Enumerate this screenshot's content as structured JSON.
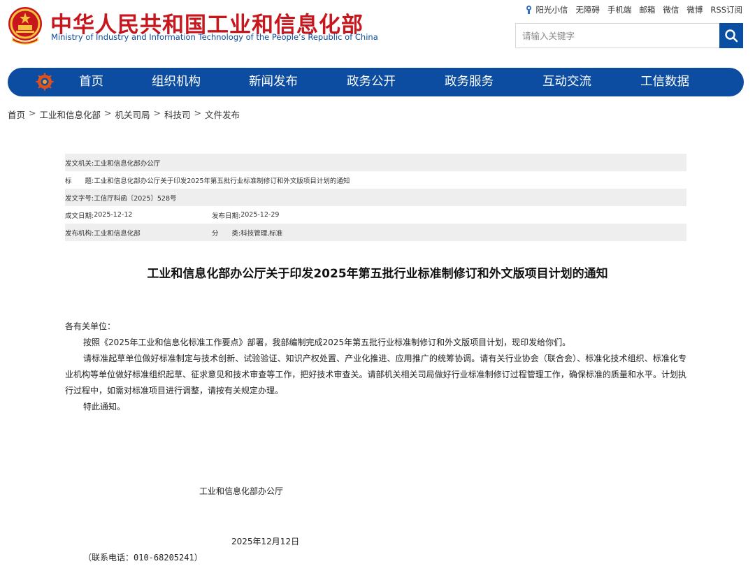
{
  "header": {
    "title": "中华人民共和国工业和信息化部",
    "subtitle": "Ministry of Industry and Information Technology of the People’s Republic of China",
    "brand_red": "#c8161d",
    "brand_blue": "#0c4da2"
  },
  "toplinks": [
    "阳光小信",
    "无障碍",
    "手机端",
    "邮箱",
    "微信",
    "微博",
    "RSS订阅"
  ],
  "search": {
    "placeholder": "请输入关键字",
    "value": ""
  },
  "nav": {
    "items": [
      "首页",
      "组织机构",
      "新闻发布",
      "政务公开",
      "政务服务",
      "互动交流",
      "工信数据"
    ]
  },
  "breadcrumb": {
    "items": [
      "首页",
      "工业和信息化部",
      "机关司局",
      "科技司",
      "文件发布"
    ],
    "separator": ">"
  },
  "meta": {
    "issuer_label": "发文机关:",
    "issuer": "工业和信息化部办公厅",
    "title_label": "标　　题:",
    "title": "工业和信息化部办公厅关于印发2025年第五批行业标准制修订和外文版项目计划的通知",
    "docno_label": "发文字号:",
    "docno": "工信厅科函〔2025〕528号",
    "created_label": "成文日期:",
    "created": "2025-12-12",
    "published_label": "发布日期:",
    "published": "2025-12-29",
    "org_label": "发布机构:",
    "org": "工业和信息化部",
    "category_label": "分　　类:",
    "category": "科技管理,标准"
  },
  "document": {
    "title": "工业和信息化部办公厅关于印发2025年第五批行业标准制修订和外文版项目计划的通知",
    "salutation": "各有关单位：",
    "paragraphs": [
      "按照《2025年工业和信息化标准工作要点》部署，我部编制完成2025年第五批行业标准制修订和外文版项目计划，现印发给你们。",
      "请标准起草单位做好标准制定与技术创新、试验验证、知识产权处置、产业化推进、应用推广的统筹协调。请有关行业协会（联合会）、标准化技术组织、标准化专业机构等单位做好标准组织起草、征求意见和技术审查等工作，把好技术审查关。请部机关相关司局做好行业标准制修订过程管理工作，确保标准的质量和水平。计划执行过程中，如需对标准项目进行调整，请按有关规定办理。",
      "特此通知。"
    ],
    "signer": "工业和信息化部办公厅",
    "sign_date": "2025年12月12日",
    "contact": "（联系电话：010-68205241）"
  }
}
